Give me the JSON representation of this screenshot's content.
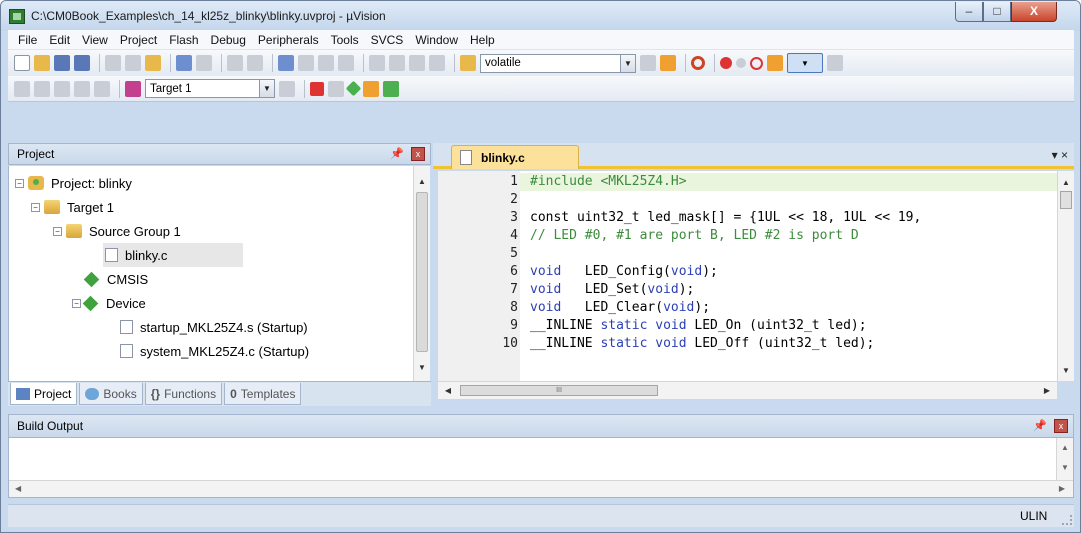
{
  "window": {
    "title": "C:\\CM0Book_Examples\\ch_14_kl25z_blinky\\blinky.uvproj - µVision",
    "minimize": "–",
    "maximize": "□",
    "close": "X"
  },
  "menu": [
    "File",
    "Edit",
    "View",
    "Project",
    "Flash",
    "Debug",
    "Peripherals",
    "Tools",
    "SVCS",
    "Window",
    "Help"
  ],
  "toolbar": {
    "find_value": "volatile",
    "target_value": "Target 1"
  },
  "project_panel": {
    "title": "Project",
    "tree": {
      "project": "Project: blinky",
      "target": "Target 1",
      "group": "Source Group 1",
      "file": "blinky.c",
      "cmsis": "CMSIS",
      "device": "Device",
      "startup": "startup_MKL25Z4.s (Startup)",
      "system": "system_MKL25Z4.c (Startup)"
    },
    "tabs": [
      "Project",
      "Books",
      "Functions",
      "Templates"
    ],
    "functions_glyph": "{}",
    "templates_glyph": "0"
  },
  "editor": {
    "tab_label": "blinky.c",
    "tab_controls": "▾ ×",
    "hscroll_thumb": "III",
    "line_numbers": [
      "1",
      "2",
      "3",
      "4",
      "5",
      "6",
      "7",
      "8",
      "9",
      "10"
    ],
    "code": {
      "l1": "#include <MKL25Z4.H>",
      "l3": "const uint32_t led_mask[] = {1UL << 18, 1UL << 19,",
      "l4": "// LED #0, #1 are port B, LED #2 is port D",
      "l6a": "void",
      "l6b": "   LED_Config(",
      "l6c": "void",
      "l6d": ");",
      "l7a": "void",
      "l7b": "   LED_Set(",
      "l7c": "void",
      "l7d": ");",
      "l8a": "void",
      "l8b": "   LED_Clear(",
      "l8c": "void",
      "l8d": ");",
      "l9a": "__INLINE ",
      "l9b": "static void",
      "l9c": " LED_On (uint32_t led);",
      "l10a": "__INLINE ",
      "l10b": "static void",
      "l10c": " LED_Off (uint32_t led);"
    }
  },
  "build_output": {
    "title": "Build Output"
  },
  "status": {
    "debugger": "ULIN"
  },
  "colors": {
    "keyword": "#2b3fb5",
    "comment": "#3d8b3d",
    "tab_accent": "#f1c232"
  }
}
